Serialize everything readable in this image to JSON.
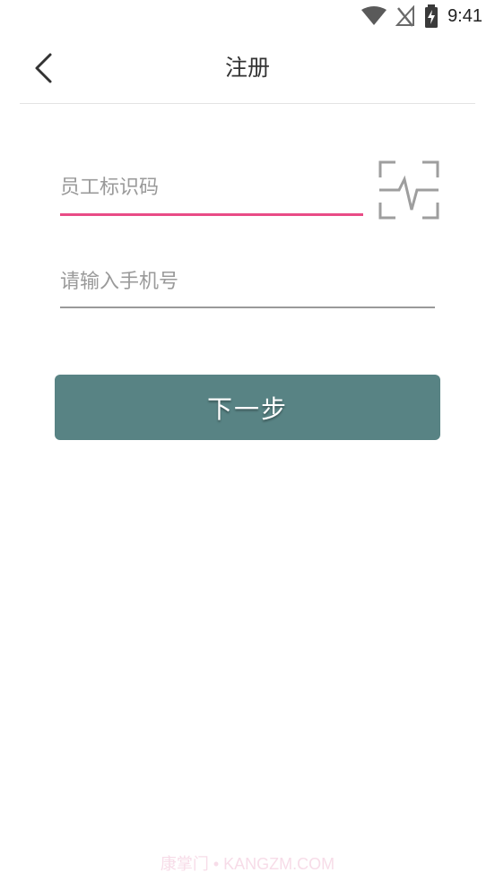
{
  "status_bar": {
    "time": "9:41"
  },
  "header": {
    "title": "注册"
  },
  "form": {
    "employee_id": {
      "placeholder": "员工标识码",
      "value": ""
    },
    "phone": {
      "placeholder": "请输入手机号",
      "value": ""
    },
    "next_label": "下一步"
  },
  "icons": {
    "back": "chevron-left-icon",
    "scan": "scan-icon",
    "wifi": "wifi-icon",
    "signal": "no-signal-icon",
    "battery": "battery-charging-icon"
  },
  "colors": {
    "accent_underline": "#e94c86",
    "button": "#588384",
    "text": "#333333",
    "placeholder": "#9a9a9a"
  },
  "watermark": "康掌门 • KANGZM.COM"
}
